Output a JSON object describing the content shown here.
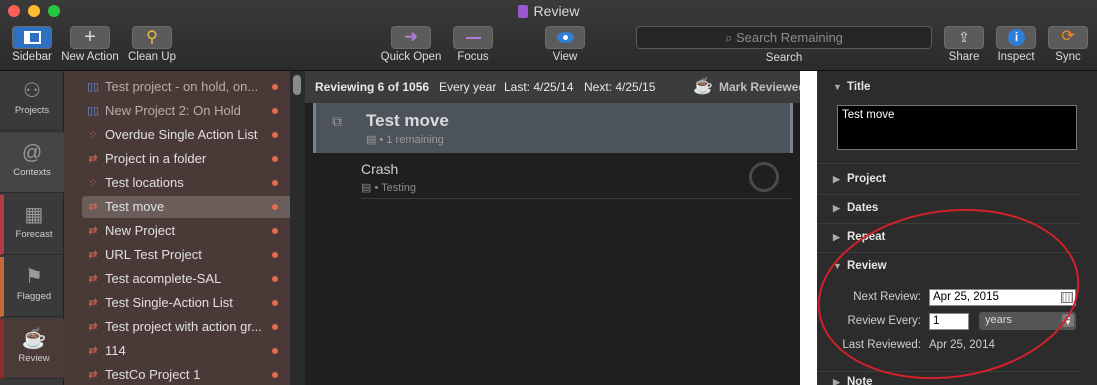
{
  "window": {
    "title": "Review"
  },
  "colors": {
    "close": "#fd5f57",
    "minimize": "#febc2e",
    "zoom": "#28c840",
    "accent_red": "#d3202a",
    "project_dot": "#e56a52"
  },
  "toolbar": {
    "sidebar": "Sidebar",
    "new_action": "New Action",
    "clean_up": "Clean Up",
    "quick_open": "Quick Open",
    "focus": "Focus",
    "view": "View",
    "search_placeholder": "Search Remaining",
    "search": "Search",
    "share": "Share",
    "inspect": "Inspect",
    "sync": "Sync"
  },
  "nav": {
    "projects": "Projects",
    "contexts": "Contexts",
    "forecast": "Forecast",
    "flagged": "Flagged",
    "review": "Review"
  },
  "projects": [
    {
      "label": "Test project - on hold, on...",
      "icon": "parallel-icon"
    },
    {
      "label": "New Project 2: On Hold",
      "icon": "parallel-icon"
    },
    {
      "label": "Overdue Single Action List",
      "icon": "single-action-icon"
    },
    {
      "label": "Project in a folder",
      "icon": "sequential-icon"
    },
    {
      "label": "Test locations",
      "icon": "single-action-icon"
    },
    {
      "label": "Test move",
      "icon": "sequential-icon"
    },
    {
      "label": "New Project",
      "icon": "sequential-icon"
    },
    {
      "label": "URL Test Project",
      "icon": "sequential-icon"
    },
    {
      "label": "Test acomplete-SAL",
      "icon": "sequential-icon"
    },
    {
      "label": "Test Single-Action List",
      "icon": "sequential-icon"
    },
    {
      "label": "Test project with action gr...",
      "icon": "sequential-icon"
    },
    {
      "label": "114",
      "icon": "sequential-icon"
    },
    {
      "label": "TestCo Project 1",
      "icon": "sequential-icon"
    }
  ],
  "review_bar": {
    "reviewing": "Reviewing 6 of 1056",
    "repeat": "Every year",
    "last": "Last: 4/25/14",
    "next": "Next: 4/25/15",
    "mark_reviewed": "Mark Reviewed"
  },
  "items": [
    {
      "title": "Test move",
      "subtitle": "• 1 remaining"
    },
    {
      "title": "Crash",
      "subtitle": "• Testing"
    }
  ],
  "inspector": {
    "title_section": "Title",
    "title_value": "Test move",
    "project": "Project",
    "dates": "Dates",
    "repeat": "Repeat",
    "review": "Review",
    "next_review_label": "Next Review:",
    "next_review_value": "Apr 25, 2015",
    "review_every_label": "Review Every:",
    "review_every_value": "1",
    "review_every_unit": "years",
    "last_reviewed_label": "Last Reviewed:",
    "last_reviewed_value": "Apr 25, 2014",
    "note": "Note"
  }
}
